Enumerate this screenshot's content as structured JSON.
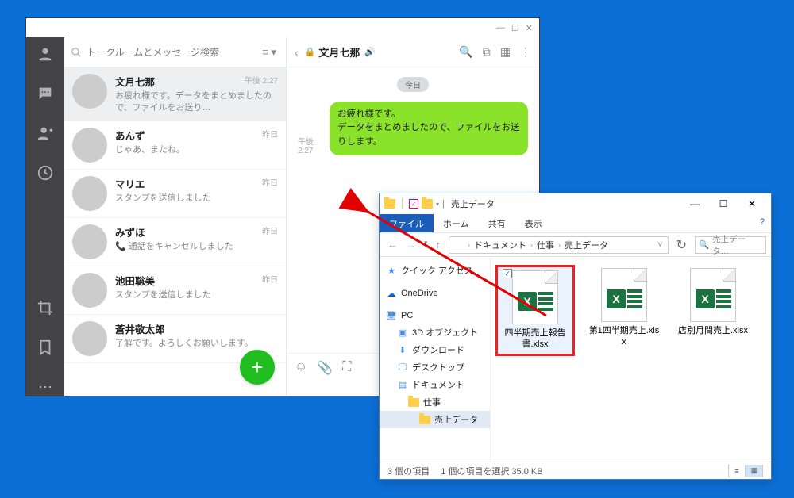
{
  "line": {
    "search_placeholder": "トークルームとメッセージ検索",
    "friends": [
      {
        "name": "文月七那",
        "preview": "お疲れ様です。データをまとめましたので、ファイルをお送り…",
        "time": "午後 2:27"
      },
      {
        "name": "あんず",
        "preview": "じゃあ、またね。",
        "time": "昨日"
      },
      {
        "name": "マリエ",
        "preview": "スタンプを送信しました",
        "time": "昨日"
      },
      {
        "name": "みずほ",
        "preview": "📞 通話をキャンセルしました",
        "time": "昨日"
      },
      {
        "name": "池田聡美",
        "preview": "スタンプを送信しました",
        "time": "昨日"
      },
      {
        "name": "蒼井敬太郎",
        "preview": "了解です。よろしくお願いします。",
        "time": ""
      }
    ],
    "chat": {
      "name": "文月七那",
      "date_label": "今日",
      "message": "お疲れ様です。\nデータをまとめましたので、ファイルをお送りします。",
      "message_time": "午後 2:27"
    }
  },
  "explorer": {
    "title": "売上データ",
    "ribbon": {
      "file": "ファイル",
      "home": "ホーム",
      "share": "共有",
      "view": "表示"
    },
    "breadcrumb": [
      "ドキュメント",
      "仕事",
      "売上データ"
    ],
    "search_placeholder": "売上データ…",
    "tree": {
      "quick": "クイック アクセス",
      "onedrive": "OneDrive",
      "pc": "PC",
      "obj3d": "3D オブジェクト",
      "downloads": "ダウンロード",
      "desktop": "デスクトップ",
      "documents": "ドキュメント",
      "work": "仕事",
      "sales": "売上データ"
    },
    "files": [
      {
        "name": "四半期売上報告書.xlsx",
        "selected": true
      },
      {
        "name": "第1四半期売上.xlsx",
        "selected": false
      },
      {
        "name": "店別月間売上.xlsx",
        "selected": false
      }
    ],
    "status": {
      "count": "3 個の項目",
      "sel": "1 個の項目を選択 35.0 KB"
    }
  }
}
